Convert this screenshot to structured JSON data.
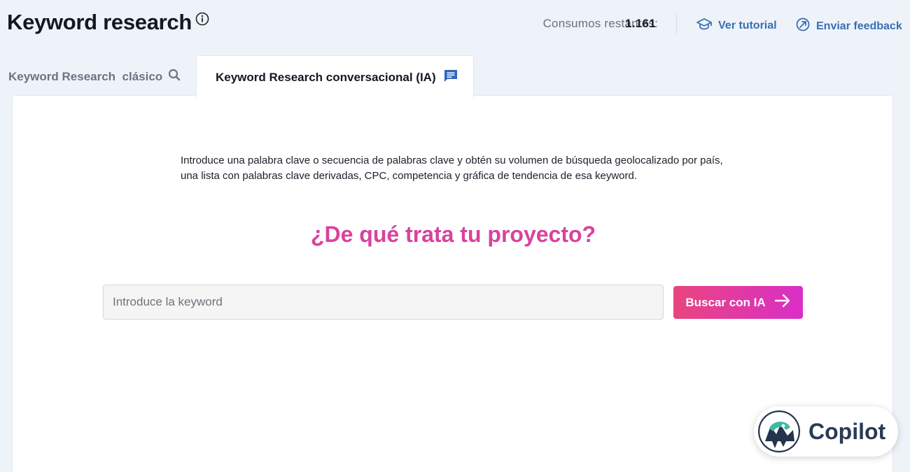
{
  "header": {
    "title": "Keyword research",
    "consumos_label": "Consumos restantes:",
    "consumos_value": "1.161",
    "tutorial_label": "Ver tutorial",
    "feedback_label": "Enviar feedback"
  },
  "tabs": {
    "classic_label": "Keyword Research  clásico",
    "ai_label": "Keyword Research conversacional (IA)"
  },
  "main": {
    "description": "Introduce una palabra clave o secuencia de palabras clave y obtén su volumen de búsqueda geolocalizado por país, una lista con palabras clave derivadas, CPC, competencia y gráfica de tendencia de esa keyword.",
    "question": "¿De qué trata tu proyecto?",
    "input_placeholder": "Introduce la keyword",
    "input_value": "",
    "search_button_label": "Buscar con IA"
  },
  "copilot": {
    "label": "Copilot"
  },
  "colors": {
    "accent_pink": "#d9429e",
    "button_gradient_start": "#e9457f",
    "button_gradient_end": "#d92fc8",
    "link_blue": "#3a6fb0",
    "background": "#eef3fa"
  }
}
